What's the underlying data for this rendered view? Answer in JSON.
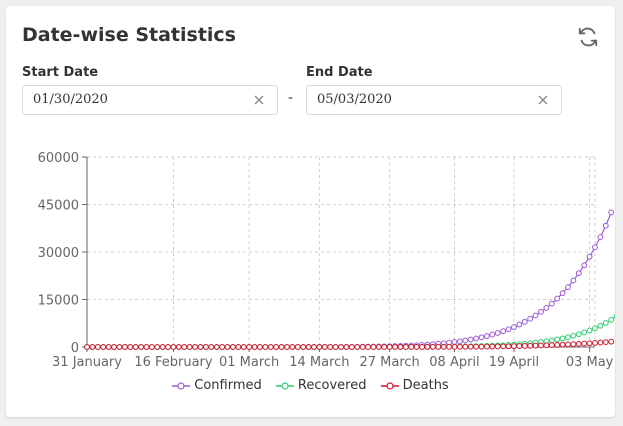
{
  "card": {
    "title": "Date-wise Statistics"
  },
  "start_date": {
    "label": "Start Date",
    "value": "01/30/2020"
  },
  "end_date": {
    "label": "End Date",
    "value": "05/03/2020"
  },
  "separator": "-",
  "icons": {
    "refresh": "refresh-icon",
    "clear": "close-icon"
  },
  "chart_data": {
    "type": "line",
    "x_start": "2020-01-31",
    "x_end": "2020-05-04",
    "x_ticks": [
      "31 January",
      "16 February",
      "01 March",
      "14 March",
      "27 March",
      "08 April",
      "19 April",
      "03 May"
    ],
    "y_ticks": [
      "0",
      "15000",
      "30000",
      "45000",
      "60000"
    ],
    "ylim": [
      0,
      60000
    ],
    "grid": true,
    "legend_position": "bottom",
    "series": [
      {
        "name": "Confirmed",
        "color": "#9b59d6",
        "values": [
          0,
          0,
          0,
          0,
          0,
          0,
          0,
          0,
          0,
          0,
          0,
          0,
          0,
          0,
          0,
          0,
          0,
          0,
          0,
          0,
          0,
          0,
          0,
          0,
          0,
          0,
          0,
          0,
          0,
          0,
          0,
          0,
          0,
          0,
          0,
          1,
          2,
          3,
          5,
          7,
          9,
          12,
          15,
          18,
          22,
          27,
          33,
          40,
          50,
          62,
          77,
          95,
          115,
          140,
          170,
          205,
          245,
          290,
          340,
          400,
          470,
          550,
          650,
          760,
          880,
          1020,
          1180,
          1360,
          1560,
          1800,
          2060,
          2350,
          2680,
          3050,
          3460,
          3920,
          4420,
          5000,
          5600,
          6300,
          7100,
          7950,
          8900,
          9950,
          11100,
          12350,
          13700,
          15300,
          17000,
          18900,
          21000,
          23300,
          25800,
          28500,
          31500,
          34700,
          38300,
          42500
        ]
      },
      {
        "name": "Recovered",
        "color": "#2ecc71",
        "values": [
          0,
          0,
          0,
          0,
          0,
          0,
          0,
          0,
          0,
          0,
          0,
          0,
          0,
          0,
          0,
          0,
          0,
          0,
          0,
          0,
          0,
          0,
          0,
          0,
          0,
          0,
          0,
          0,
          0,
          0,
          0,
          0,
          0,
          0,
          0,
          0,
          0,
          0,
          0,
          0,
          0,
          0,
          0,
          0,
          0,
          0,
          0,
          0,
          0,
          0,
          1,
          1,
          2,
          3,
          4,
          6,
          8,
          10,
          13,
          17,
          22,
          28,
          35,
          44,
          55,
          68,
          84,
          103,
          125,
          150,
          180,
          215,
          255,
          300,
          350,
          410,
          480,
          560,
          650,
          760,
          880,
          1020,
          1180,
          1360,
          1570,
          1810,
          2080,
          2390,
          2730,
          3120,
          3560,
          4050,
          4600,
          5200,
          5900,
          6700,
          7600,
          8600,
          9700,
          11000,
          12000
        ]
      },
      {
        "name": "Deaths",
        "color": "#d4142a",
        "values": [
          0,
          0,
          0,
          0,
          0,
          0,
          0,
          0,
          0,
          0,
          0,
          0,
          0,
          0,
          0,
          0,
          0,
          0,
          0,
          0,
          0,
          0,
          0,
          0,
          0,
          0,
          0,
          0,
          0,
          0,
          0,
          0,
          0,
          0,
          0,
          0,
          0,
          0,
          0,
          0,
          0,
          0,
          0,
          0,
          0,
          0,
          0,
          0,
          0,
          0,
          0,
          1,
          1,
          2,
          3,
          4,
          5,
          6,
          8,
          10,
          12,
          15,
          18,
          22,
          26,
          31,
          37,
          44,
          52,
          61,
          72,
          84,
          98,
          114,
          132,
          152,
          175,
          200,
          228,
          260,
          295,
          334,
          377,
          424,
          476,
          532,
          593,
          660,
          732,
          810,
          895,
          985,
          1080,
          1180,
          1290,
          1410,
          1540,
          1680
        ]
      }
    ]
  }
}
